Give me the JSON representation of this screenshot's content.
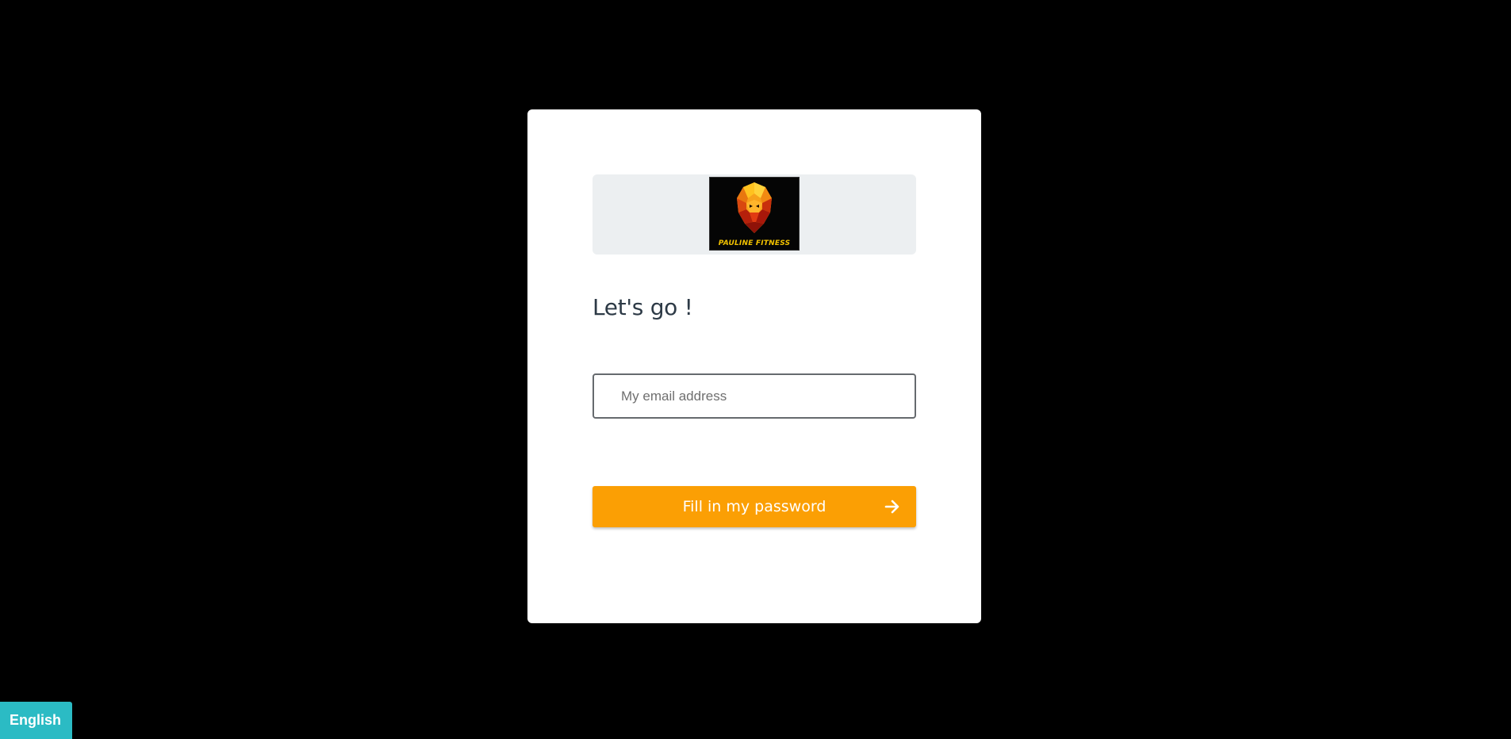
{
  "login": {
    "logo_text": "PAULINE FITNESS",
    "heading": "Let's go !",
    "email_placeholder": "My email address",
    "email_value": "",
    "submit_label": "Fill in my password"
  },
  "language": {
    "selected": "English"
  },
  "colors": {
    "page_background": "#000000",
    "card_background": "#ffffff",
    "banner_background": "#eceff1",
    "accent_orange": "#fb9f04",
    "language_teal": "#2bbbc4",
    "heading_text": "#2d3a46"
  },
  "icons": {
    "logo": "lion-head-logo",
    "submit": "arrow-right-icon"
  }
}
